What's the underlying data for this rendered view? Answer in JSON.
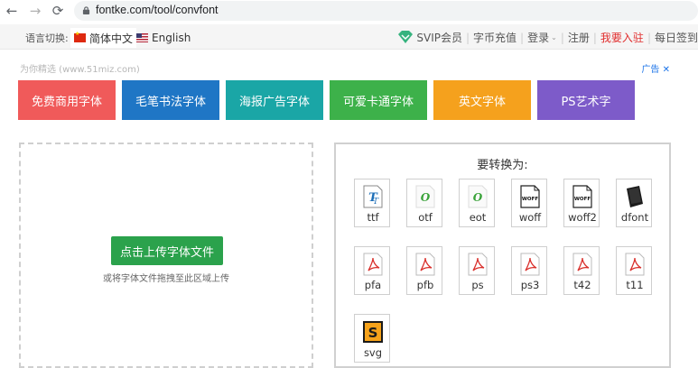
{
  "browser": {
    "url": "fontke.com/tool/convfont"
  },
  "site_nav": {
    "lang_label": "语言切换:",
    "lang_zh": "简体中文",
    "lang_en": "English",
    "vip": "SVIP会员",
    "recharge": "字币充值",
    "login": "登录",
    "register": "注册",
    "join": "我要入驻",
    "daily": "每日签到"
  },
  "ad": {
    "tag": "为你精选 (www.51miz.com)",
    "close": "广告 ✕"
  },
  "categories": [
    {
      "label": "免费商用字体",
      "color": "#f05a5a"
    },
    {
      "label": "毛笔书法字体",
      "color": "#1f76c5"
    },
    {
      "label": "海报广告字体",
      "color": "#1aa6a6"
    },
    {
      "label": "可爱卡通字体",
      "color": "#3db14a"
    },
    {
      "label": "英文字体",
      "color": "#f5a11d"
    },
    {
      "label": "PS艺术字",
      "color": "#7d5bc9"
    }
  ],
  "upload": {
    "button": "点击上传字体文件",
    "hint": "或将字体文件拖拽至此区域上传"
  },
  "convert": {
    "title": "要转换为:",
    "formats": [
      {
        "label": "ttf",
        "icon": "ttf-file-icon"
      },
      {
        "label": "otf",
        "icon": "otf-file-icon"
      },
      {
        "label": "eot",
        "icon": "eot-file-icon"
      },
      {
        "label": "woff",
        "icon": "woff-file-icon"
      },
      {
        "label": "woff2",
        "icon": "woff2-file-icon"
      },
      {
        "label": "dfont",
        "icon": "dfont-file-icon"
      },
      {
        "label": "pfa",
        "icon": "pdf-file-icon"
      },
      {
        "label": "pfb",
        "icon": "pdf-file-icon"
      },
      {
        "label": "ps",
        "icon": "pdf-file-icon"
      },
      {
        "label": "ps3",
        "icon": "pdf-file-icon"
      },
      {
        "label": "t42",
        "icon": "pdf-file-icon"
      },
      {
        "label": "t11",
        "icon": "pdf-file-icon"
      },
      {
        "label": "svg",
        "icon": "svg-file-icon"
      }
    ]
  }
}
